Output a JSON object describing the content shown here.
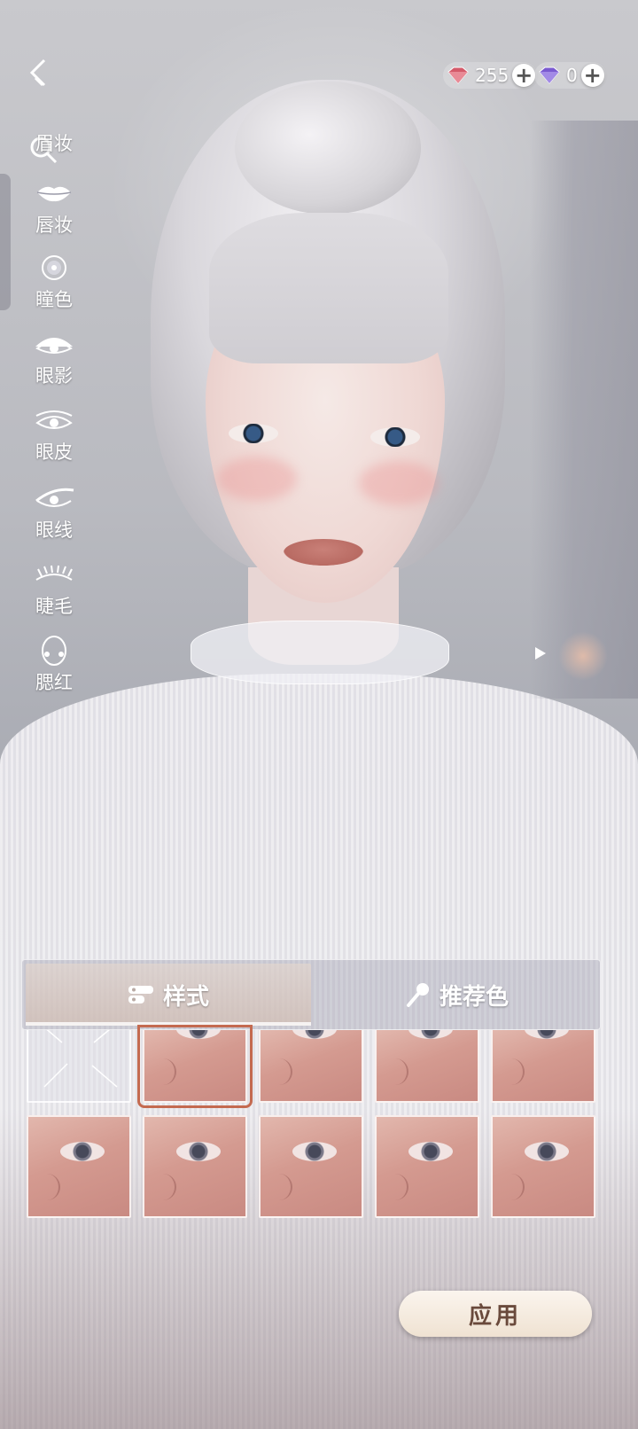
{
  "header": {
    "currency_red": {
      "amount": "255",
      "icon": "red-gem-icon",
      "color": "#d45a6a"
    },
    "currency_purple": {
      "amount": "0",
      "icon": "purple-gem-icon",
      "color": "#7a5ad0"
    },
    "plus_label": "+"
  },
  "categories": [
    {
      "label": "眉妆",
      "icon": "eyebrow-icon"
    },
    {
      "label": "唇妆",
      "icon": "lips-icon"
    },
    {
      "label": "瞳色",
      "icon": "pupil-icon"
    },
    {
      "label": "眼影",
      "icon": "eyeshadow-icon"
    },
    {
      "label": "眼皮",
      "icon": "eyelid-icon"
    },
    {
      "label": "眼线",
      "icon": "eyeliner-icon"
    },
    {
      "label": "睫毛",
      "icon": "eyelash-icon"
    },
    {
      "label": "腮红",
      "icon": "blush-icon",
      "active": true
    }
  ],
  "tabs": [
    {
      "label": "样式",
      "icon": "style-icon",
      "active": true
    },
    {
      "label": "推荐色",
      "icon": "brush-icon",
      "active": false
    }
  ],
  "grid": {
    "selected_index": 1,
    "rows": 2,
    "columns": 5
  },
  "apply_label": "应用",
  "colors": {
    "accent_selected": "#c46a50",
    "apply_text": "#6a4a3c"
  }
}
